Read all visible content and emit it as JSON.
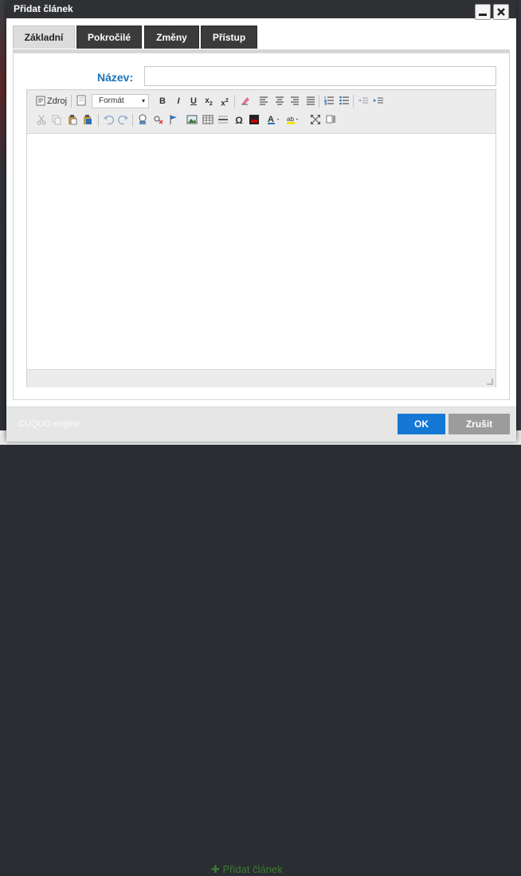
{
  "dialog": {
    "title": "Přidat článek",
    "minimize_icon": "minimize-icon",
    "close_icon": "close-icon"
  },
  "tabs": [
    {
      "label": "Základní",
      "active": true
    },
    {
      "label": "Pokročilé",
      "active": false
    },
    {
      "label": "Změny",
      "active": false
    },
    {
      "label": "Přístup",
      "active": false
    }
  ],
  "form": {
    "name_label": "Název:",
    "name_value": "",
    "name_placeholder": ""
  },
  "editor": {
    "source_label": "Zdroj",
    "format_label": "Formát",
    "toolbar_row1": [
      "source-icon",
      "templates-icon",
      "format-select",
      "bold-icon",
      "italic-icon",
      "underline-icon",
      "subscript-icon",
      "superscript-icon",
      "remove-format-icon",
      "align-left-icon",
      "align-center-icon",
      "align-right-icon",
      "justify-icon",
      "numbered-list-icon",
      "bulleted-list-icon",
      "outdent-icon",
      "indent-icon"
    ],
    "toolbar_row2": [
      "cut-icon",
      "copy-icon",
      "paste-icon",
      "paste-text-icon",
      "undo-icon",
      "redo-icon",
      "link-icon",
      "unlink-icon",
      "anchor-icon",
      "image-icon",
      "table-icon",
      "horizontal-line-icon",
      "special-char-icon",
      "youtube-icon",
      "text-color-icon",
      "bg-color-icon",
      "maximize-icon",
      "show-blocks-icon"
    ],
    "content": ""
  },
  "footer": {
    "engine_label": "CUQUO engine",
    "ok_label": "OK",
    "cancel_label": "Zrušit"
  },
  "background": {
    "bottom_link": "✚ Přidat článek"
  },
  "colors": {
    "accent": "#1478d4",
    "label_blue": "#1a73b8",
    "titlebar": "#2f3135",
    "tab_inactive": "#3b3b3b"
  }
}
